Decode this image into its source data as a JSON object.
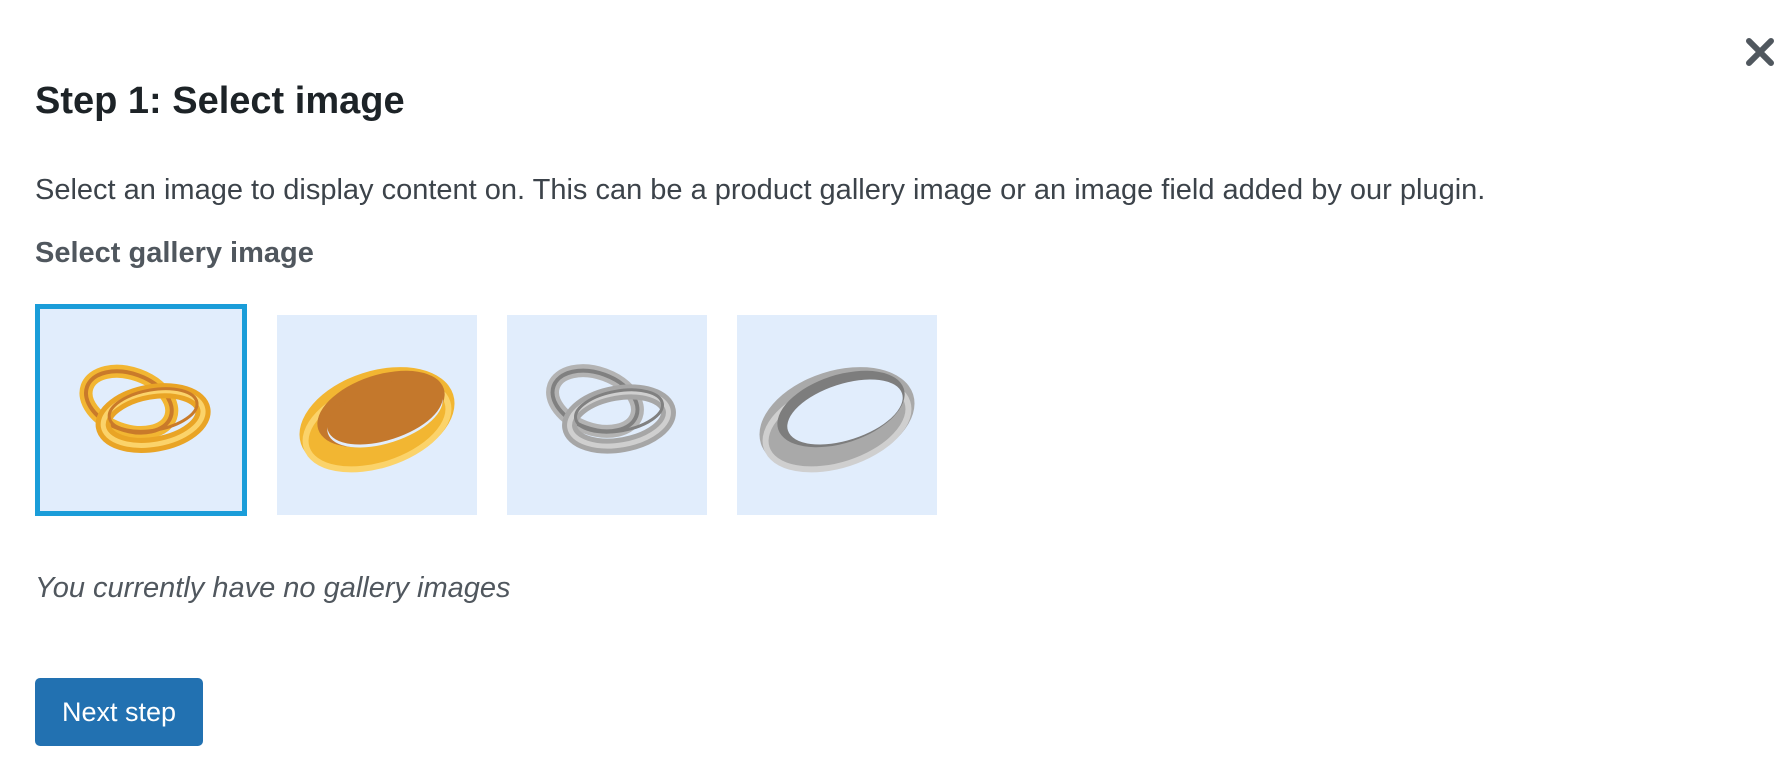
{
  "modal": {
    "close_icon": "close-icon",
    "title": "Step 1: Select image",
    "description": "Select an image to display content on. This can be a product gallery image or an image field added by our plugin.",
    "gallery_heading": "Select gallery image",
    "empty_note": "You currently have no gallery images",
    "next_button_label": "Next step"
  },
  "gallery": {
    "selected_index": 0,
    "selection_color": "#1a9dd9",
    "thumbnail_background": "#e1edfc",
    "images": [
      {
        "subject": "gold-interlocked-rings",
        "color": "gold",
        "selected": true
      },
      {
        "subject": "gold-single-ring",
        "color": "gold",
        "selected": false
      },
      {
        "subject": "silver-interlocked-rings",
        "color": "silver",
        "selected": false
      },
      {
        "subject": "silver-single-ring",
        "color": "silver",
        "selected": false
      }
    ]
  },
  "colors": {
    "primary_button": "#2271b1",
    "title_text": "#1d2327",
    "body_text": "#50575e"
  }
}
